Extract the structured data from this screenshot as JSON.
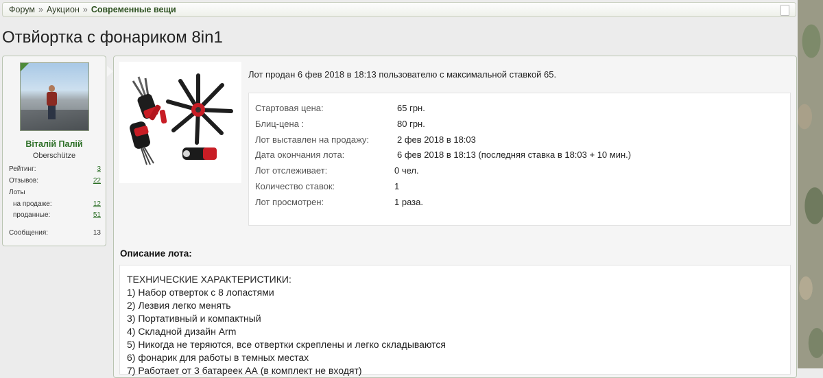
{
  "breadcrumb": {
    "items": [
      "Форум",
      "Аукцион"
    ],
    "separator": "»",
    "current": "Современные вещи"
  },
  "title": "Отвйортка с фонариком 8in1",
  "user": {
    "name": "Віталій Палій",
    "rank": "Oberschütze",
    "stats": {
      "rating_label": "Рейтинг:",
      "rating": "3",
      "reviews_label": "Отзывов:",
      "reviews": "22",
      "lots_label": "Лоты",
      "on_sale_label": "на продаже:",
      "on_sale": "12",
      "sold_label": "проданные:",
      "sold": "51",
      "messages_label": "Сообщения:",
      "messages": "13"
    }
  },
  "lot": {
    "sold_text": "Лот продан 6 фев 2018 в 18:13 пользователю с максимальной ставкой 65.",
    "rows": [
      {
        "label": "Стартовая цена:",
        "value": "65 грн."
      },
      {
        "label": "Блиц-цена :",
        "value": "80 грн."
      },
      {
        "label": "Лот выставлен на продажу:",
        "value": "2 фев 2018 в 18:03"
      },
      {
        "label": "Дата окончания лота:",
        "value": "6 фев 2018 в 18:13 (последняя ставка в 18:03 + 10 мин.)"
      },
      {
        "label": "Лот отслеживает:",
        "value": "0 чел."
      },
      {
        "label": "Количество ставок:",
        "value": "1"
      },
      {
        "label": "Лот просмотрен:",
        "value": "1 раза."
      }
    ]
  },
  "description": {
    "heading": "Описание лота:",
    "lines": [
      "ТЕХНИЧЕСКИЕ ХАРАКТЕРИСТИКИ:",
      "1) Набор отверток с 8 лопастями",
      "2) Лезвия легко менять",
      "3) Портативный и компактный",
      "4) Складной дизайн Arm",
      "5) Никогда не теряются, все отвертки скреплены и легко складываются",
      "6) фонарик для работы в темных местах",
      "7) Работает от 3 батареек АА (в комплект не входят)"
    ]
  }
}
